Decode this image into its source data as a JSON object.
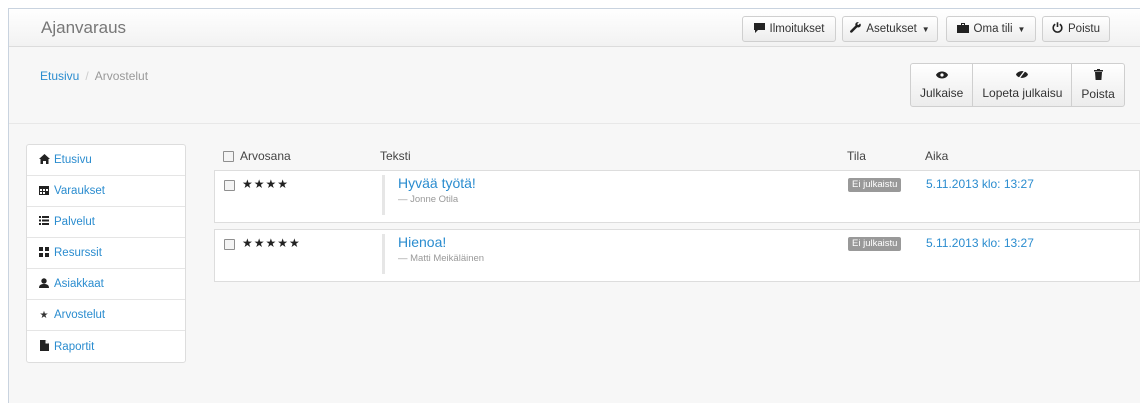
{
  "navbar": {
    "brand": "Ajanvaraus",
    "buttons": {
      "notifications": "Ilmoitukset",
      "settings": "Asetukset",
      "account": "Oma tili",
      "logout": "Poistu"
    }
  },
  "breadcrumb": {
    "home": "Etusivu",
    "separator": "/",
    "current": "Arvostelut"
  },
  "actions": {
    "publish": "Julkaise",
    "unpublish": "Lopeta julkaisu",
    "delete": "Poista"
  },
  "sidebar": {
    "items": [
      {
        "label": "Etusivu",
        "icon": "home-icon"
      },
      {
        "label": "Varaukset",
        "icon": "calendar-icon"
      },
      {
        "label": "Palvelut",
        "icon": "list-icon"
      },
      {
        "label": "Resurssit",
        "icon": "grid-icon"
      },
      {
        "label": "Asiakkaat",
        "icon": "user-icon"
      },
      {
        "label": "Arvostelut",
        "icon": "star-icon"
      },
      {
        "label": "Raportit",
        "icon": "file-icon"
      }
    ]
  },
  "table": {
    "headers": {
      "rating": "Arvosana",
      "text": "Teksti",
      "status": "Tila",
      "time": "Aika"
    },
    "rows": [
      {
        "stars": "★★★★",
        "title": "Hyvää työtä!",
        "author": "— Jonne Otila",
        "status": "Ei julkaistu",
        "time": "5.11.2013 klo: 13:27"
      },
      {
        "stars": "★★★★★",
        "title": "Hienoa!",
        "author": "— Matti Meikäläinen",
        "status": "Ei julkaistu",
        "time": "5.11.2013 klo: 13:27"
      }
    ]
  },
  "colors": {
    "link": "#2a8ccf",
    "badge": "#999999"
  }
}
